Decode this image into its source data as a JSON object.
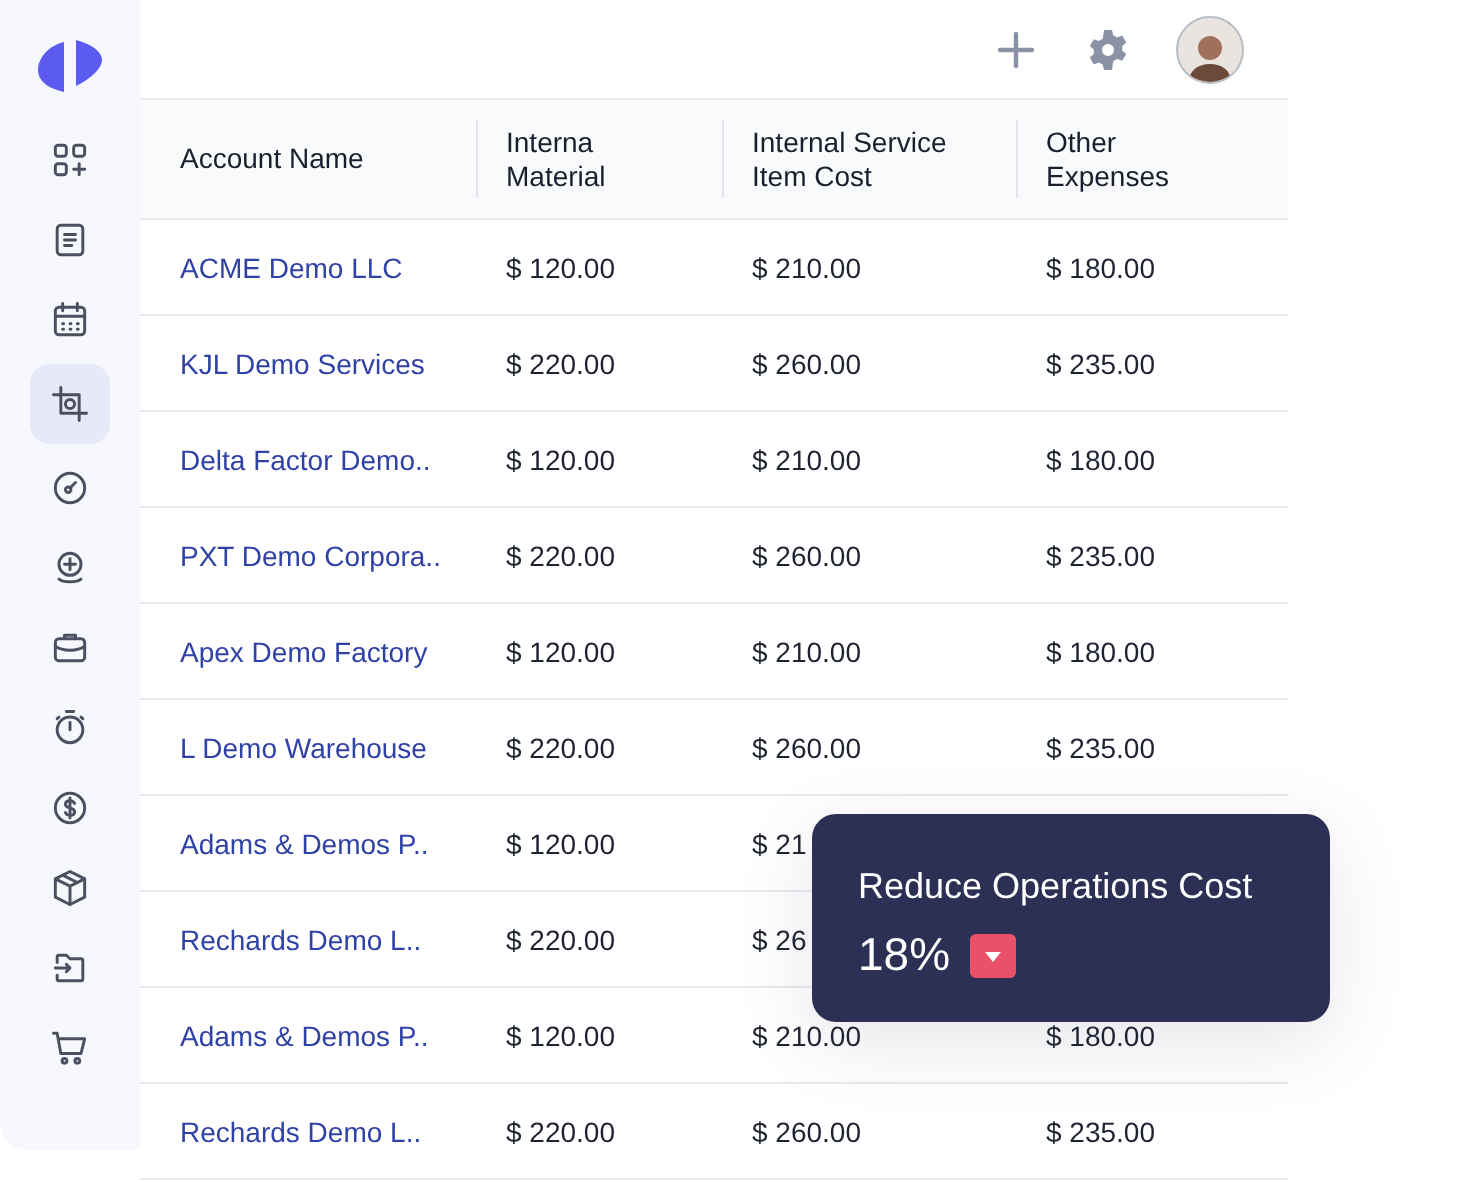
{
  "sidebar": {
    "items": [
      {
        "selected": false
      },
      {
        "selected": false
      },
      {
        "selected": false
      },
      {
        "selected": true
      },
      {
        "selected": false
      },
      {
        "selected": false
      },
      {
        "selected": false
      },
      {
        "selected": false
      },
      {
        "selected": false
      },
      {
        "selected": false
      },
      {
        "selected": false
      },
      {
        "selected": false
      }
    ]
  },
  "table": {
    "columns": [
      "Account Name",
      "Interna\nMaterial",
      "Internal Service\nItem Cost",
      "Other\nExpenses"
    ],
    "rows": [
      {
        "cells": [
          "ACME Demo LLC",
          "$ 120.00",
          "$ 210.00",
          "$ 180.00"
        ]
      },
      {
        "cells": [
          "KJL Demo Services",
          "$ 220.00",
          "$ 260.00",
          "$ 235.00"
        ]
      },
      {
        "cells": [
          "Delta Factor Demo..",
          "$ 120.00",
          "$ 210.00",
          "$ 180.00"
        ]
      },
      {
        "cells": [
          "PXT Demo Corpora..",
          "$ 220.00",
          "$ 260.00",
          "$ 235.00"
        ]
      },
      {
        "cells": [
          "Apex Demo Factory",
          "$ 120.00",
          "$ 210.00",
          "$ 180.00"
        ]
      },
      {
        "cells": [
          "L Demo Warehouse",
          "$ 220.00",
          "$ 260.00",
          "$ 235.00"
        ]
      },
      {
        "cells": [
          "Adams & Demos P..",
          "$ 120.00",
          "$ 21",
          null
        ]
      },
      {
        "cells": [
          "Rechards Demo L..",
          "$ 220.00",
          "$ 26",
          null
        ]
      },
      {
        "cells": [
          "Adams & Demos P..",
          "$ 120.00",
          "$ 210.00",
          "$ 180.00"
        ]
      },
      {
        "cells": [
          "Rechards Demo L..",
          "$ 220.00",
          "$ 260.00",
          "$ 235.00"
        ]
      }
    ]
  },
  "popup": {
    "title": "Reduce Operations Cost",
    "value": "18%"
  }
}
